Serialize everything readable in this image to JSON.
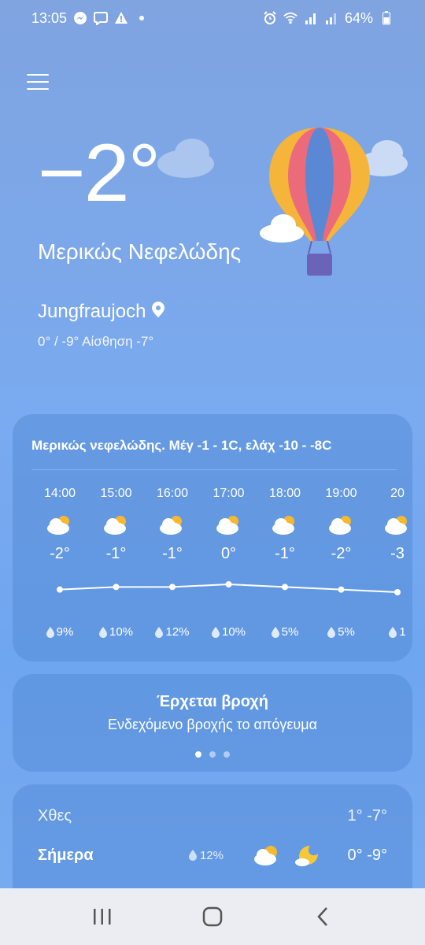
{
  "status_bar": {
    "time": "13:05",
    "battery": "64%",
    "icons": [
      "messenger-icon",
      "viber-icon",
      "warning-icon",
      "dot-icon",
      "alarm-icon",
      "wifi-icon",
      "signal-icon",
      "signal-icon",
      "battery-icon"
    ]
  },
  "current": {
    "temperature": "−2°",
    "condition": "Μερικώς Νεφελώδης",
    "location": "Jungfraujoch",
    "minmax_feel": "0° / -9° Αίσθηση -7°"
  },
  "hourly": {
    "summary": "Μερικώς νεφελώδης. Μέγ -1 - 1C, ελάχ -10 - -8C",
    "hours": [
      {
        "time": "14:00",
        "temp": "-2°",
        "rain": "9%",
        "value": -2
      },
      {
        "time": "15:00",
        "temp": "-1°",
        "rain": "10%",
        "value": -1
      },
      {
        "time": "16:00",
        "temp": "-1°",
        "rain": "12%",
        "value": -1
      },
      {
        "time": "17:00",
        "temp": "0°",
        "rain": "10%",
        "value": 0
      },
      {
        "time": "18:00",
        "temp": "-1°",
        "rain": "5%",
        "value": -1
      },
      {
        "time": "19:00",
        "temp": "-2°",
        "rain": "5%",
        "value": -2
      },
      {
        "time": "20",
        "temp": "-3",
        "rain": "1",
        "value": -3
      }
    ]
  },
  "rain_alert": {
    "title": "Έρχεται βροχή",
    "subtitle": "Ενδεχόμενο βροχής το απόγευμα",
    "pages": 3,
    "active_page": 0
  },
  "daily": [
    {
      "day": "Χθες",
      "rain": "",
      "temps": "1° -7°"
    },
    {
      "day": "Σήμερα",
      "rain": "12%",
      "temps": "0° -9°"
    }
  ],
  "colors": {
    "background": "#7aaaf0",
    "sun": "#f5b82e",
    "moon": "#f5c83a",
    "balloon_basket": "#6a63b8"
  }
}
